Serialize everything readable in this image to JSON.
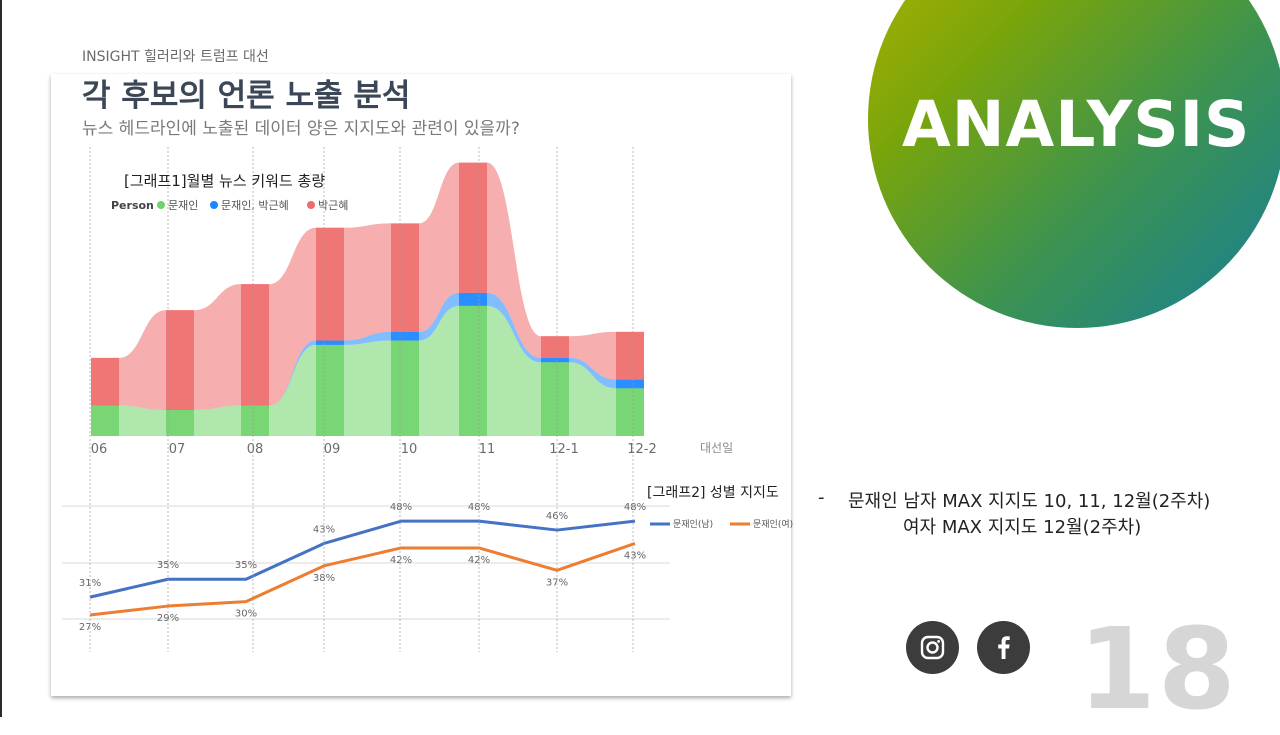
{
  "header": {
    "eyebrow": "INSIGHT 힐러리와 트럼프 대선",
    "title": "각 후보의 언론 노출 분석",
    "subtitle": "뉴스 헤드라인에 노출된 데이터 양은 지지도와 관련이 있을까?"
  },
  "badge": {
    "label": "ANALYSIS",
    "gradient": [
      "#b5b300",
      "#3c9350",
      "#167e9a"
    ]
  },
  "notes": {
    "dash": "-",
    "line1": "문재인 남자 MAX 지지도 10, 11, 12월(2주차)",
    "line2": "여자 MAX 지지도 12월(2주차)"
  },
  "social": {
    "icons": [
      "instagram-icon",
      "facebook-icon"
    ]
  },
  "page_number": "18",
  "colors": {
    "green": "#6ed36a",
    "blue": "#1a86ff",
    "red": "#ee6b6b",
    "male": "#4472c4",
    "female": "#ed7d31"
  },
  "chart_data": [
    {
      "type": "area",
      "title": "[그래프1]월별 뉴스 키워드 총량",
      "legend_title": "Person",
      "legend_placement": "top-left",
      "xlabel": "대선일",
      "categories": [
        "06",
        "07",
        "08",
        "09",
        "10",
        "11",
        "12-1",
        "12-2"
      ],
      "stacking": "stacked",
      "series": [
        {
          "name": "문재인",
          "values": [
            7,
            6,
            7,
            21,
            22,
            30,
            17,
            11
          ]
        },
        {
          "name": "문재인, 박근혜",
          "values": [
            0,
            0,
            0,
            1,
            2,
            3,
            1,
            2
          ]
        },
        {
          "name": "박근혜",
          "values": [
            11,
            23,
            28,
            26,
            25,
            30,
            5,
            11
          ]
        }
      ],
      "ylim": [
        0,
        65
      ],
      "grid": false
    },
    {
      "type": "line",
      "title": "[그래프2] 성별 지지도",
      "legend_placement": "right",
      "categories": [
        "06",
        "07",
        "08",
        "09",
        "10",
        "11",
        "12-1",
        "12-2"
      ],
      "series": [
        {
          "name": "문재인(남)",
          "values": [
            31,
            35,
            35,
            43,
            48,
            48,
            46,
            48
          ],
          "labels": [
            "31%",
            "35%",
            "35%",
            "43%",
            "48%",
            "48%",
            "46%",
            "48%"
          ]
        },
        {
          "name": "문재인(여)",
          "values": [
            27,
            29,
            30,
            38,
            42,
            42,
            37,
            43
          ],
          "labels": [
            "27%",
            "29%",
            "30%",
            "38%",
            "42%",
            "42%",
            "37%",
            "43%"
          ]
        }
      ],
      "ylim": [
        20,
        55
      ],
      "grid": true
    }
  ]
}
